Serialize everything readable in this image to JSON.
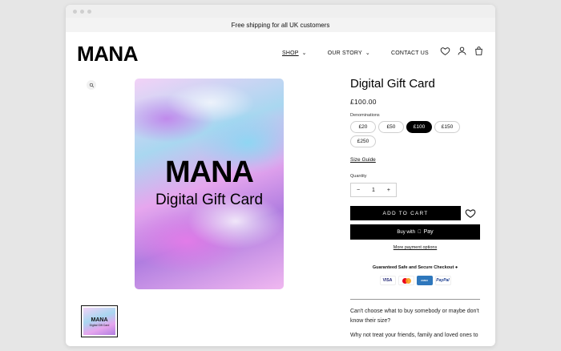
{
  "announcement": "Free shipping for all UK customers",
  "brand": "MANA",
  "nav": [
    {
      "label": "SHOP"
    },
    {
      "label": "OUR STORY"
    },
    {
      "label": "CONTACT US"
    }
  ],
  "header_icons": [
    "heart-icon",
    "user-icon",
    "bag-icon"
  ],
  "product": {
    "card_title": "MANA",
    "card_subtitle": "Digital Gift Card",
    "title": "Digital Gift Card",
    "price": "£100.00",
    "denominations_label": "Denominations",
    "denominations": [
      "£20",
      "£50",
      "£100",
      "£150",
      "£250"
    ],
    "selected_denomination": "£100",
    "size_guide": "Size Guide",
    "quantity_label": "Quantity",
    "quantity": "1",
    "minus": "−",
    "plus": "+",
    "add_to_cart": "ADD TO CART",
    "buy_with_prefix": "Buy with",
    "buy_with_brand": "Pay",
    "more_payment": "More payment options",
    "secure_text": "Guaranteed Safe and Secure Checkout",
    "payment_cards": [
      "VISA",
      "Mastercard",
      "AMERICAN EXPRESS",
      "PayPal"
    ],
    "description_1": "Can't choose what to buy somebody or maybe don't know their size?",
    "description_2": "Why not treat your friends, family and loved ones to"
  },
  "thumbnail": {
    "title": "MANA",
    "subtitle": "Digital Gift Card"
  }
}
